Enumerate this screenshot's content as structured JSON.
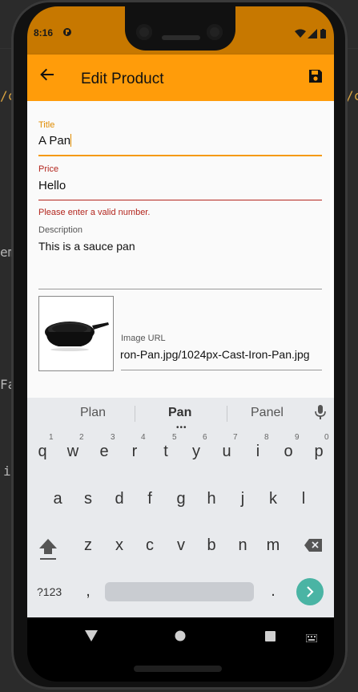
{
  "status_bar": {
    "time": "8:16"
  },
  "app_bar": {
    "title": "Edit Product"
  },
  "form": {
    "title": {
      "label": "Title",
      "value": "A Pan"
    },
    "price": {
      "label": "Price",
      "value": "Hello",
      "error": "Please enter a valid number."
    },
    "description": {
      "label": "Description",
      "value": "This is a sauce pan"
    },
    "image_url": {
      "label": "Image URL",
      "value": "ron-Pan.jpg/1024px-Cast-Iron-Pan.jpg"
    }
  },
  "keyboard": {
    "suggestions": [
      "Plan",
      "Pan",
      "Panel"
    ],
    "row1": [
      "q",
      "w",
      "e",
      "r",
      "t",
      "y",
      "u",
      "i",
      "o",
      "p"
    ],
    "row1_hints": [
      "1",
      "2",
      "3",
      "4",
      "5",
      "6",
      "7",
      "8",
      "9",
      "0"
    ],
    "row2": [
      "a",
      "s",
      "d",
      "f",
      "g",
      "h",
      "j",
      "k",
      "l"
    ],
    "row3": [
      "z",
      "x",
      "c",
      "v",
      "b",
      "n",
      "m"
    ],
    "symbols_label": "?123",
    "comma": ",",
    "period": "."
  },
  "colors": {
    "accent": "#ff9c0a",
    "status_bar": "#c77800",
    "error": "#b3261e",
    "enter_key": "#4ab4a4"
  }
}
